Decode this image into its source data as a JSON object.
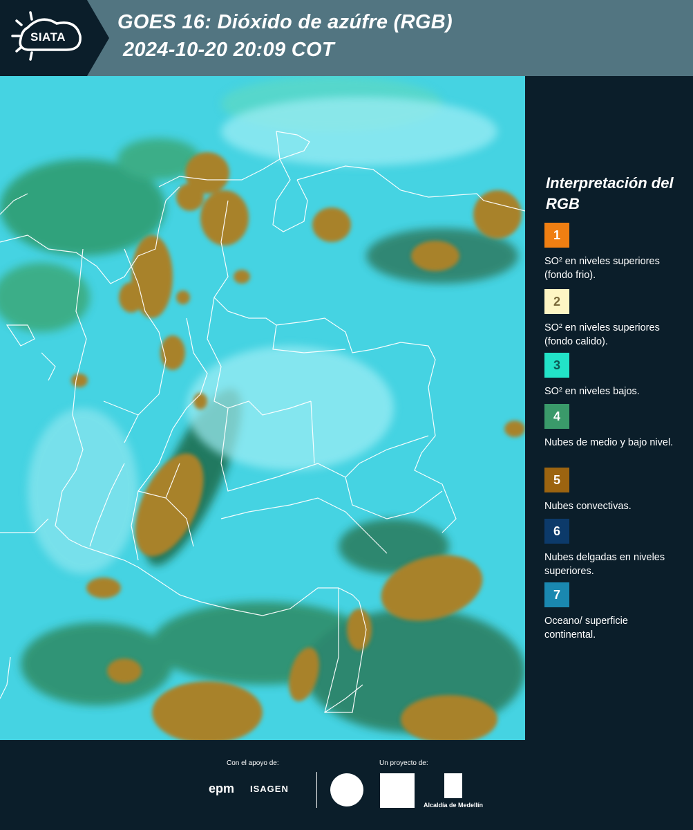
{
  "header": {
    "logo": "SIATA",
    "title_line1": "GOES 16: Dióxido de azúfre (RGB)",
    "title_line2": "2024-10-20 20:09 COT"
  },
  "legend": {
    "title": "Interpretación del RGB",
    "items": [
      {
        "number": "1",
        "label": "SO² en niveles superiores (fondo frio).",
        "color": "#f07f12",
        "text_color": "#ffffff"
      },
      {
        "number": "2",
        "label": "SO² en niveles superiores (fondo calido).",
        "color": "#fef6c4",
        "text_color": "#7a6a3a"
      },
      {
        "number": "3",
        "label": "SO² en niveles bajos.",
        "color": "#22e3c8",
        "text_color": "#0d5a55"
      },
      {
        "number": "4",
        "label": "Nubes de medio y bajo nivel.",
        "color": "#3a9a6a",
        "text_color": "#ffffff"
      },
      {
        "number": "5",
        "label": "Nubes convectivas.",
        "color": "#9c6410",
        "text_color": "#ffffff"
      },
      {
        "number": "6",
        "label": "Nubes delgadas en niveles superiores.",
        "color": "#0c3a6a",
        "text_color": "#ffffff"
      },
      {
        "number": "7",
        "label": "Oceano/ superficie continental.",
        "color": "#1a88b0",
        "text_color": "#ffffff"
      }
    ]
  },
  "footer": {
    "support_label": "Con el apoyo de:",
    "project_label": "Un proyecto de:",
    "epm": "epm",
    "isagen": "ISAGEN",
    "alcaldia": "Alcaldía de Medellín"
  },
  "colors": {
    "header_bg": "#527581",
    "panel_bg": "#0b1e2a",
    "surface_cyan": "#3fd6e0",
    "convective_brown": "#a8822c",
    "mid_cloud_green": "#2f8a4a"
  }
}
